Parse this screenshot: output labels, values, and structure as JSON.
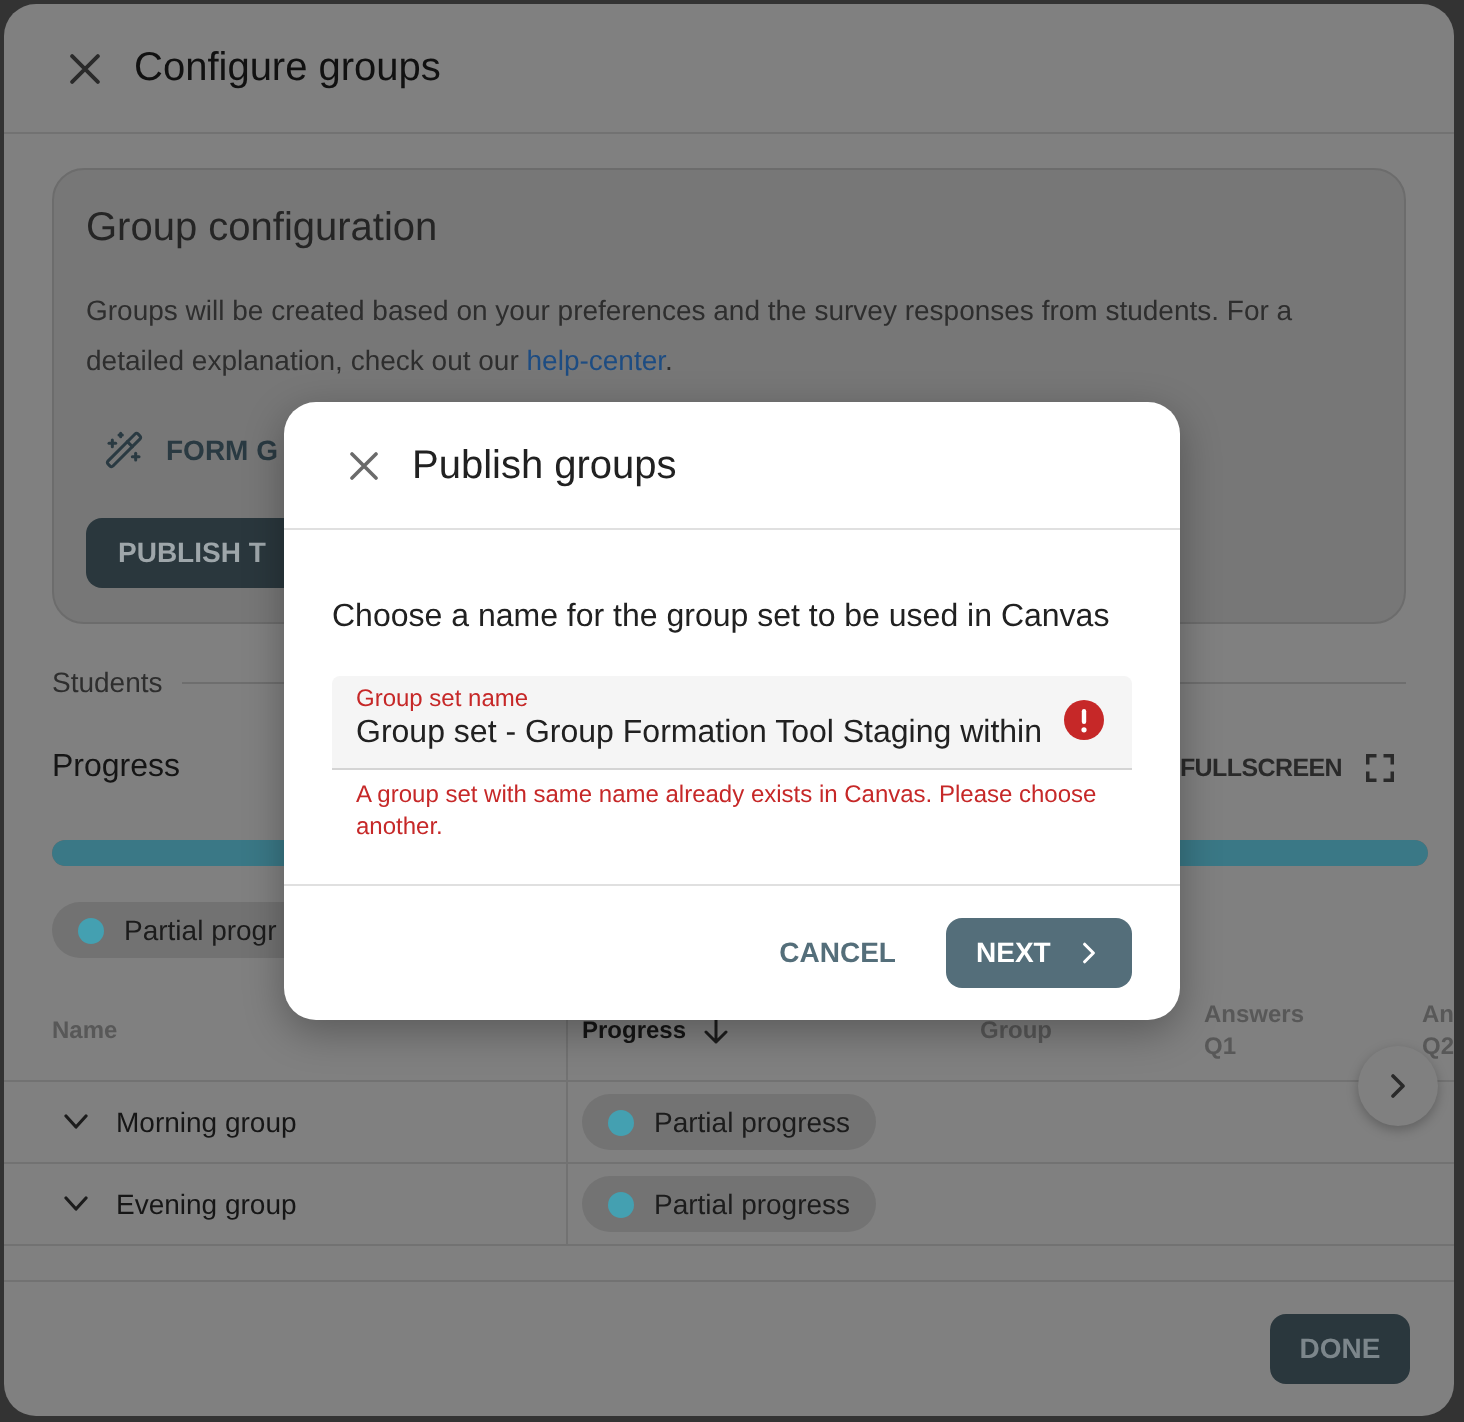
{
  "background_dialog": {
    "title": "Configure groups"
  },
  "group_configuration": {
    "title": "Group configuration",
    "description": "Groups will be created based on your preferences and the survey responses from students. For a detailed explanation, check out our ",
    "link": "help-center",
    "description_end": ".",
    "form_button": "FORM G",
    "publish_button": "PUBLISH T"
  },
  "students": {
    "section_label": "Students",
    "title": "Progress",
    "fullscreen_button": "FULLSCREEN",
    "progress_bar": {
      "level": 1
    },
    "legend": [
      {
        "label": "Partial progr"
      }
    ]
  },
  "table": {
    "columns": [
      {
        "label": "Name",
        "sorted": false
      },
      {
        "label": "Progress",
        "sorted": true
      },
      {
        "label": "Group",
        "sorted": false
      },
      {
        "label": "Answers Q1",
        "sorted": false
      },
      {
        "label": "An Q2",
        "sorted": false
      }
    ],
    "rows": [
      {
        "name": "Morning group",
        "progress": "Partial progress"
      },
      {
        "name": "Evening group",
        "progress": "Partial progress"
      }
    ]
  },
  "footer": {
    "done_button": "DONE"
  },
  "publish_dialog": {
    "title": "Publish groups",
    "prompt": "Choose a name for the group set to be used in Canvas",
    "field": {
      "label": "Group set name",
      "value": "Group set - Group Formation Tool Staging within",
      "error": true,
      "helper": "A group set with same name already exists in Canvas. Please choose another."
    },
    "buttons": [
      {
        "label": "CANCEL",
        "kind": "text"
      },
      {
        "label": "NEXT",
        "kind": "primary"
      }
    ]
  }
}
